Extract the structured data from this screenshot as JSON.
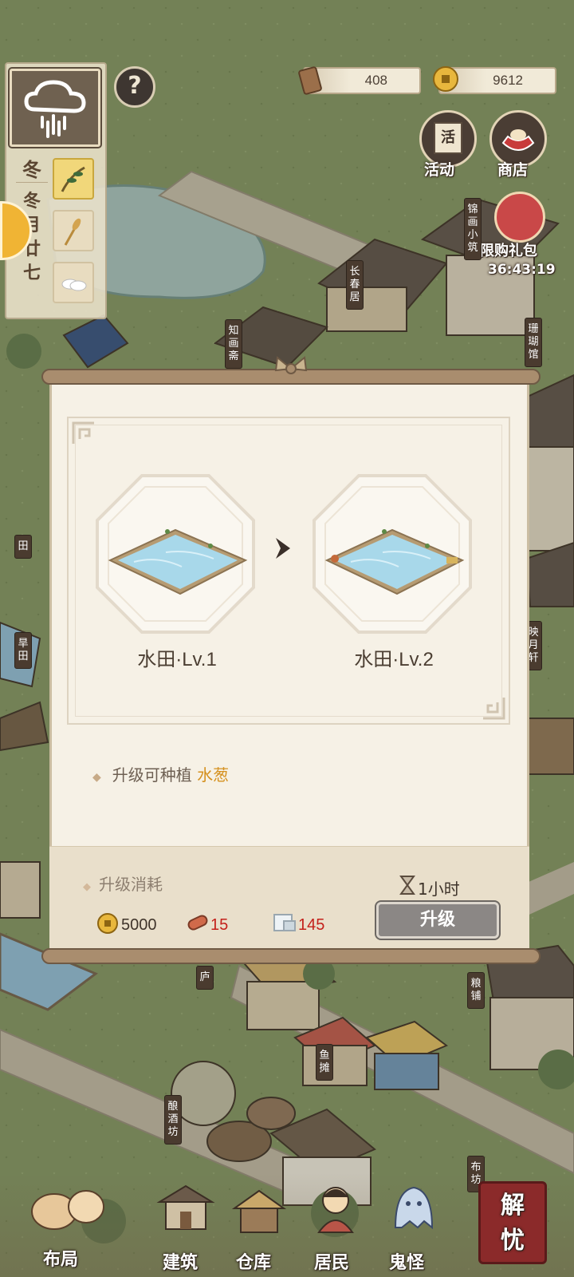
{
  "resources": {
    "wood": "408",
    "coins": "9612"
  },
  "calendar": {
    "season": "冬",
    "date_lines": [
      "冬",
      "月",
      "廿",
      "七"
    ]
  },
  "top_buttons": {
    "activity": "活动",
    "activity_badge": "活",
    "shop": "商店",
    "limited_pack": "限购礼包",
    "limited_timer": "36:43:19"
  },
  "help": "?",
  "buildings": {
    "jinhua": "锦画小筑",
    "changchun": "长春居",
    "zhihua": "知画斋",
    "shanhu": "珊瑚馆",
    "yingyue": "映月轩",
    "hantian": "旱田",
    "liangpu": "粮铺",
    "yutan": "鱼摊",
    "niangjiu": "酿酒坊",
    "bufang": "布坊",
    "tian": "田",
    "lu": "庐"
  },
  "dialog": {
    "from": {
      "name": "水田",
      "level": "Lv.1"
    },
    "to": {
      "name": "水田",
      "level": "Lv.2"
    },
    "note_prefix": "升级可种植",
    "note_crop": "水葱",
    "cost_title": "升级消耗",
    "time": "1小时",
    "costs": {
      "coins": "5000",
      "wood": "15",
      "stone": "145"
    },
    "upgrade_label": "升级"
  },
  "nav": {
    "layout": "布局",
    "build": "建筑",
    "storage": "仓库",
    "residents": "居民",
    "ghosts": "鬼怪",
    "jieyou": "解忧"
  },
  "colors": {
    "cost_shortfall": "#c4211b",
    "crop_highlight": "#d5911f",
    "button_disabled": "#8b8785"
  }
}
